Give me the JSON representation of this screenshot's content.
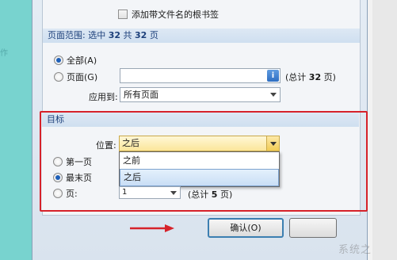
{
  "background": {
    "left_ghost_text": "作"
  },
  "dialog": {
    "bookmark_option": {
      "label": "添加带文件名的根书签",
      "checked": false
    },
    "page_range": {
      "header_prefix": "页面范围: 选中",
      "selected_count": "32",
      "header_mid": "共",
      "total_count": "32",
      "header_suffix": "页",
      "options": [
        {
          "label": "全部(A)",
          "selected": true
        },
        {
          "label": "页面(G)",
          "selected": false
        }
      ],
      "pages_input_value": "",
      "info_icon": "i",
      "total_note_prefix": "(总计",
      "total_note_count": "32",
      "total_note_suffix": "页)",
      "apply_to_label": "应用到:",
      "apply_to_value": "所有页面"
    },
    "target": {
      "header": "目标",
      "position_label": "位置:",
      "position_value": "之后",
      "dropdown_options": [
        {
          "label": "之前",
          "selected": false
        },
        {
          "label": "之后",
          "selected": true
        }
      ],
      "options": [
        {
          "label": "第一页",
          "selected": false
        },
        {
          "label": "最末页",
          "selected": true
        },
        {
          "label": "页:",
          "selected": false
        }
      ],
      "page_number_value": "1",
      "page_total_prefix": "(总计",
      "page_total_count": "5",
      "page_total_suffix": "页)"
    },
    "buttons": {
      "ok_label": "确认(O)",
      "cancel_label": ""
    }
  },
  "watermark": "系统之",
  "colors": {
    "highlight_frame": "#d6222a",
    "selection_blue": "#1e5fb8",
    "combo_highlight": "#fbe69a"
  }
}
